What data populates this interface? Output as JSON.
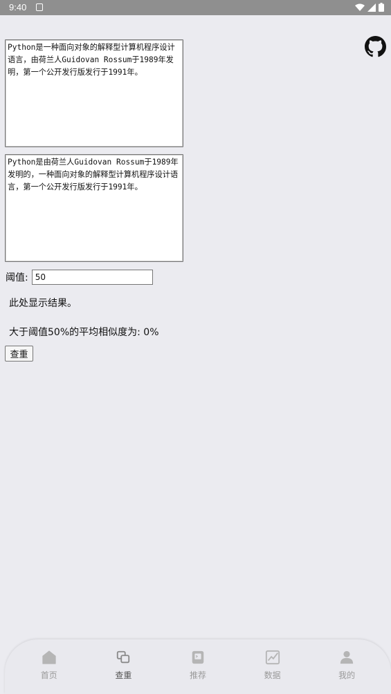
{
  "status_bar": {
    "time": "9:40"
  },
  "texts": {
    "text1": "Python是一种面向对象的解释型计算机程序设计语言，由荷兰人Guidovan Rossum于1989年发明，第一个公开发行版发行于1991年。",
    "text2": "Python是由荷兰人Guidovan Rossum于1989年发明的，一种面向对象的解释型计算机程序设计语言，第一个公开发行版发行于1991年。"
  },
  "threshold": {
    "label": "阈值:",
    "value": "50"
  },
  "result": {
    "text": "此处显示结果。",
    "average": "大于阈值50%的平均相似度为: 0%"
  },
  "buttons": {
    "check": "查重"
  },
  "nav": [
    {
      "label": "首页",
      "icon": "home-icon"
    },
    {
      "label": "查重",
      "icon": "copy-icon"
    },
    {
      "label": "推荐",
      "icon": "recommend-icon"
    },
    {
      "label": "数据",
      "icon": "chart-icon"
    },
    {
      "label": "我的",
      "icon": "user-icon"
    }
  ],
  "colors": {
    "background": "#ebebf0",
    "status_bar": "#8f8f8f",
    "nav_inactive": "#9a9a9a"
  }
}
